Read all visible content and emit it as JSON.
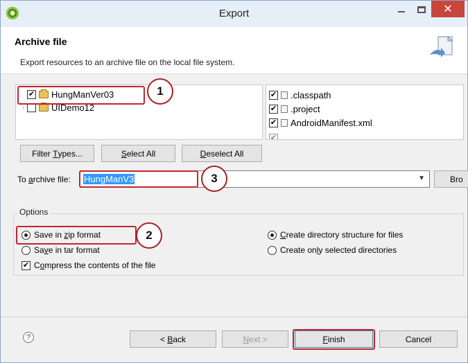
{
  "window": {
    "title": "Export"
  },
  "header": {
    "title": "Archive file",
    "description": "Export resources to an archive file on the local file system."
  },
  "projects": [
    {
      "label": "HungManVer03",
      "checked": true
    },
    {
      "label": "UIDemo12",
      "checked": false
    }
  ],
  "files": [
    {
      "label": ".classpath",
      "checked": true
    },
    {
      "label": ".project",
      "checked": true
    },
    {
      "label": "AndroidManifest.xml",
      "checked": true
    }
  ],
  "buttons": {
    "filter_types": {
      "pre": "Filter ",
      "key": "T",
      "post": "ypes..."
    },
    "select_all": {
      "key": "S",
      "post": "elect All"
    },
    "deselect_all": {
      "key": "D",
      "post": "eselect All"
    },
    "back": {
      "pre": "< ",
      "key": "B",
      "post": "ack"
    },
    "next": {
      "key": "N",
      "post": "ext >"
    },
    "finish": {
      "key": "F",
      "post": "inish"
    },
    "cancel": "Cancel",
    "browse": "Bro"
  },
  "archive": {
    "label_pre": "To ",
    "label_key": "a",
    "label_post": "rchive file:",
    "value": "HungManV3"
  },
  "options": {
    "title": "Options",
    "zip": {
      "pre": "Save in ",
      "key": "z",
      "post": "ip format",
      "selected": true
    },
    "tar": {
      "pre": "Sa",
      "key": "v",
      "post": "e in tar format",
      "selected": false
    },
    "compress": {
      "pre": "C",
      "key": "o",
      "post": "mpress the contents of the file",
      "checked": true
    },
    "dir_structure": {
      "key": "C",
      "post": "reate directory structure for files",
      "selected": true
    },
    "selected_dirs": {
      "pre": "Create on",
      "key": "l",
      "post": "y selected directories",
      "selected": false
    }
  },
  "callouts": [
    "1",
    "2",
    "3"
  ],
  "colors": {
    "accent": "#3399ff",
    "callout": "#c0262d",
    "close": "#c9463d"
  },
  "icons": {
    "help": "?",
    "close": "✕"
  }
}
